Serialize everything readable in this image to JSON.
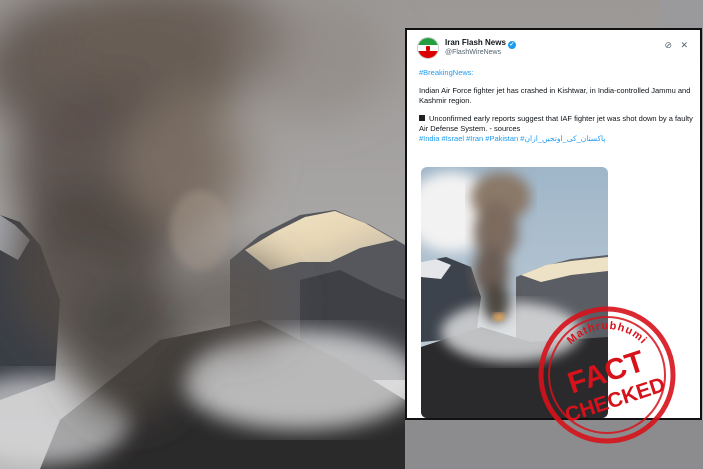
{
  "tweet": {
    "author_name": "Iran Flash News",
    "author_handle": "@FlashWireNews",
    "hashtag_breaking": "#BreakingNews:",
    "line1": "Indian Air Force fighter jet has crashed in Kishtwar, in India-controlled Jammu and Kashmir region.",
    "line2": "Unconfirmed early reports suggest that IAF fighter jet was shot down by a faulty Air Defense System. - sources",
    "hashtags": "#India #Israel #Iran #Pakistan #پاکستان_کی_اوتجیں_ازان"
  },
  "stamp": {
    "top_text": "Mathrubhumi",
    "word1": "FACT",
    "word2": "CHECKED"
  },
  "colors": {
    "link": "#1d9bf0",
    "stamp_red": "#d6121b",
    "flag_green": "#239f40",
    "flag_red": "#da0000"
  },
  "icons": [
    "verified-icon",
    "grok-icon",
    "close-icon",
    "flag-icon"
  ]
}
